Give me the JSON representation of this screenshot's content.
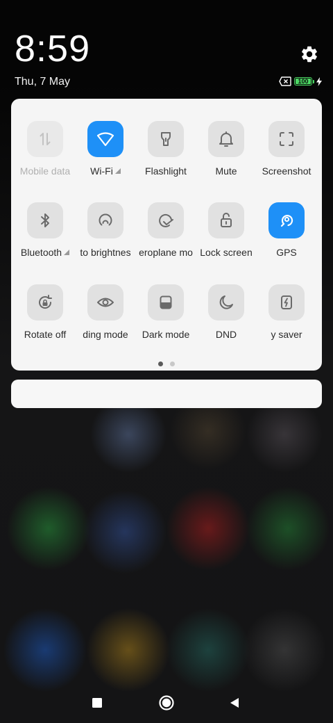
{
  "status_bar": {
    "time": "8:59",
    "date": "Thu, 7 May",
    "battery_label": "100",
    "battery_level_percent": 100,
    "icons": [
      "settings-icon",
      "no-sim-icon",
      "battery-icon",
      "charging-icon"
    ]
  },
  "quick_settings": {
    "tiles": [
      {
        "id": "mobile-data",
        "label": "Mobile data",
        "icon": "mobile-data-icon",
        "state": "disabled"
      },
      {
        "id": "wifi",
        "label": "Wi-Fi",
        "icon": "wifi-icon",
        "state": "on",
        "has_expand": true
      },
      {
        "id": "flashlight",
        "label": "Flashlight",
        "icon": "flashlight-icon",
        "state": "off"
      },
      {
        "id": "mute",
        "label": "Mute",
        "icon": "bell-icon",
        "state": "off"
      },
      {
        "id": "screenshot",
        "label": "Screenshot",
        "icon": "screenshot-icon",
        "state": "off"
      },
      {
        "id": "bluetooth",
        "label": "Bluetooth",
        "icon": "bluetooth-icon",
        "state": "off",
        "has_expand": true
      },
      {
        "id": "auto-brightness",
        "label": "to brightnes",
        "icon": "auto-brightness-icon",
        "state": "off"
      },
      {
        "id": "aeroplane-mode",
        "label": "eroplane mo",
        "icon": "airplane-icon",
        "state": "off"
      },
      {
        "id": "lock-screen",
        "label": "Lock screen",
        "icon": "lock-icon",
        "state": "off"
      },
      {
        "id": "gps",
        "label": "GPS",
        "icon": "gps-icon",
        "state": "on"
      },
      {
        "id": "rotate",
        "label": "Rotate off",
        "icon": "rotate-lock-icon",
        "state": "off"
      },
      {
        "id": "reading-mode",
        "label": "ding mode",
        "icon": "eye-icon",
        "state": "off"
      },
      {
        "id": "dark-mode",
        "label": "Dark mode",
        "icon": "dark-mode-icon",
        "state": "off"
      },
      {
        "id": "dnd",
        "label": "DND",
        "icon": "moon-icon",
        "state": "off"
      },
      {
        "id": "battery-saver",
        "label": "y saver",
        "icon": "battery-saver-icon",
        "state": "off"
      }
    ],
    "pages": 2,
    "current_page": 1
  },
  "colors": {
    "accent": "#1e90f7",
    "panel": "#f5f5f5",
    "tile_off": "#e1e1e1",
    "battery": "#4cd964"
  },
  "nav_bar": {
    "icons": [
      "recents-icon",
      "home-icon",
      "back-icon"
    ]
  }
}
